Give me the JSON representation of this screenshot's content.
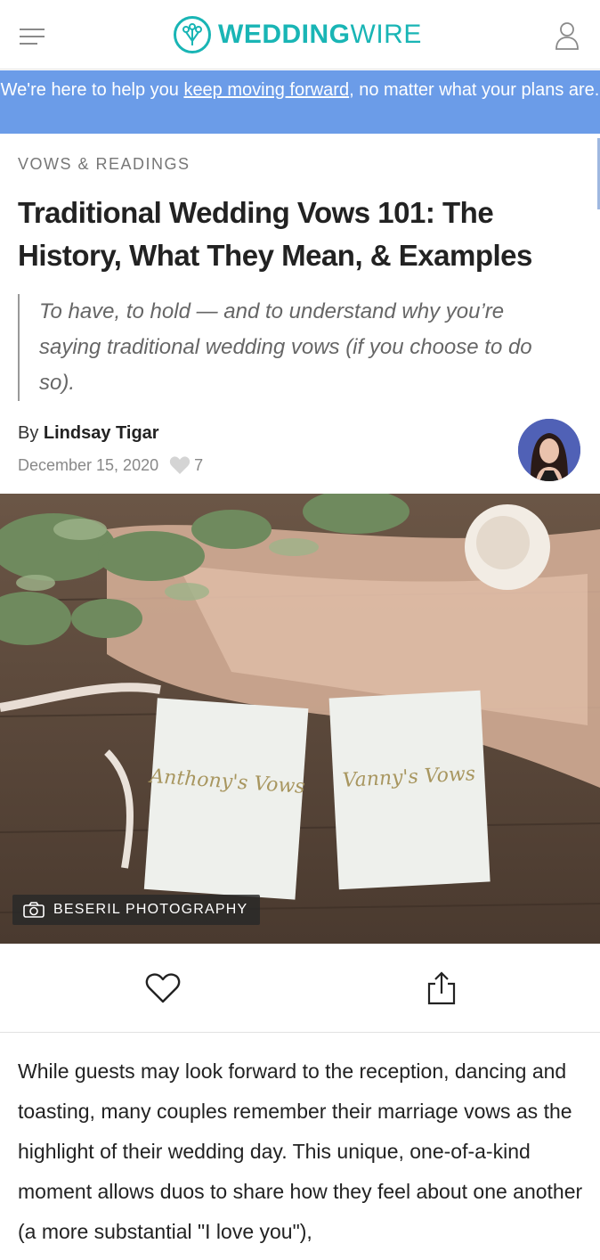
{
  "header": {
    "logo_bold": "WEDDING",
    "logo_light": "WIRE",
    "menu_icon": "hamburger-menu-icon",
    "user_icon": "user-profile-icon"
  },
  "banner": {
    "text_before": "We're here to help you ",
    "link_text": "keep moving forward",
    "text_after": ", no matter what your plans are.",
    "background": "#6b9ce8"
  },
  "article": {
    "category": "VOWS & READINGS",
    "title": "Traditional Wedding Vows 101: The History, What They Mean, & Examples",
    "subtitle": "To have, to hold — and to understand why you’re saying traditional wedding vows (if you choose to do so).",
    "author_prefix": "By ",
    "author_name": "Lindsay Tigar",
    "date": "December 15, 2020",
    "likes": "7",
    "photo_credit": "BESERIL PHOTOGRAPHY",
    "body": "While guests may look forward to the reception, dancing and toasting, many couples remember their marriage vows as the highlight of their wedding day. This unique, one-of-a-kind moment allows duos to share how they feel about one another (a more substantial \"I love you\"),"
  },
  "photo": {
    "left_card_text": "Anthony's Vows",
    "right_card_text": "Vanny's Vows"
  },
  "colors": {
    "brand": "#19b5b5",
    "banner": "#6b9ce8"
  }
}
